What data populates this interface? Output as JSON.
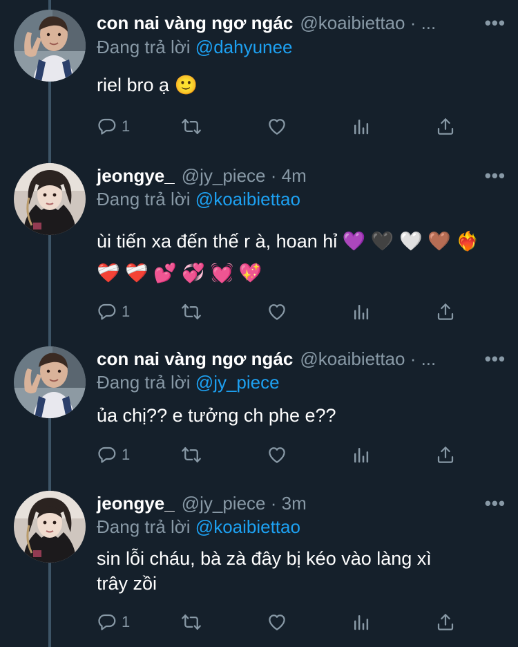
{
  "reply_prefix": "Đang trả lời",
  "more_label": "•••",
  "tweets": [
    {
      "name": "con nai vàng ngơ ngác",
      "handle": "@koaibiettao · ...",
      "replying_to": "@dahyunee",
      "text_line1": "riel bro ạ 🙂",
      "text_line2": "",
      "reply_count": "1"
    },
    {
      "name": "jeongye_",
      "handle": "@jy_piece · 4m",
      "replying_to": "@koaibiettao",
      "text_line1": "ùi tiến xa đến thế r à, hoan hỉ 💜 🖤 🤍 🤎 ❤️‍🔥",
      "text_line2": "❤️‍🩹 ❤️‍🩹 💕 💞 💓 💖",
      "reply_count": "1"
    },
    {
      "name": "con nai vàng ngơ ngác",
      "handle": "@koaibiettao · ...",
      "replying_to": "@jy_piece",
      "text_line1": "ủa chị?? e tưởng ch phe e??",
      "text_line2": "",
      "reply_count": "1"
    },
    {
      "name": "jeongye_",
      "handle": "@jy_piece · 3m",
      "replying_to": "@koaibiettao",
      "text_line1": "sin lỗi cháu, bà zà đây bị kéo vào làng xì",
      "text_line2": "trây zồi",
      "reply_count": "1"
    }
  ],
  "colors": {
    "background": "#15202b",
    "secondary_text": "#8899a6",
    "link": "#1da1f2",
    "thread_line": "#3d5466"
  }
}
